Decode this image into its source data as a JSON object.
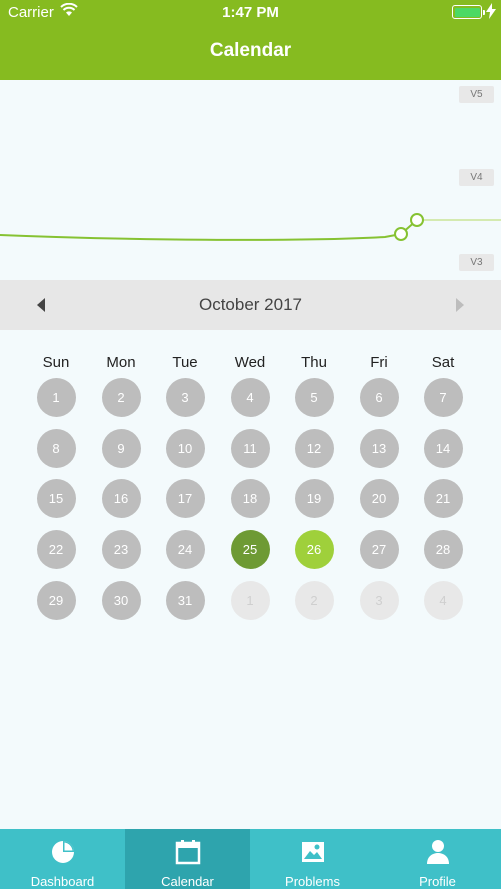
{
  "status_bar": {
    "carrier": "Carrier",
    "time": "1:47 PM"
  },
  "header": {
    "title": "Calendar"
  },
  "chart": {
    "level_labels": [
      "V5",
      "V4",
      "V3"
    ],
    "line_color": "#86c232"
  },
  "calendar": {
    "month_label": "October 2017",
    "weekdays": [
      "Sun",
      "Mon",
      "Tue",
      "Wed",
      "Thu",
      "Fri",
      "Sat"
    ],
    "days": [
      "1",
      "2",
      "3",
      "4",
      "5",
      "6",
      "7",
      "8",
      "9",
      "10",
      "11",
      "12",
      "13",
      "14",
      "15",
      "16",
      "17",
      "18",
      "19",
      "20",
      "21",
      "22",
      "23",
      "24",
      "25",
      "26",
      "27",
      "28",
      "29",
      "30",
      "31",
      "1",
      "2",
      "3",
      "4"
    ],
    "today": "25",
    "selected": "26"
  },
  "tabbar": {
    "tabs": [
      {
        "label": "Dashboard",
        "icon": "pie-chart-icon"
      },
      {
        "label": "Calendar",
        "icon": "calendar-icon",
        "active": true
      },
      {
        "label": "Problems",
        "icon": "image-icon"
      },
      {
        "label": "Profile",
        "icon": "person-icon"
      }
    ]
  },
  "colors": {
    "accent": "#86bb20",
    "tab_bar": "#3fc0c8",
    "tab_active": "#2ea4ad",
    "today": "#6e9a34",
    "selected": "#9fd03b"
  }
}
